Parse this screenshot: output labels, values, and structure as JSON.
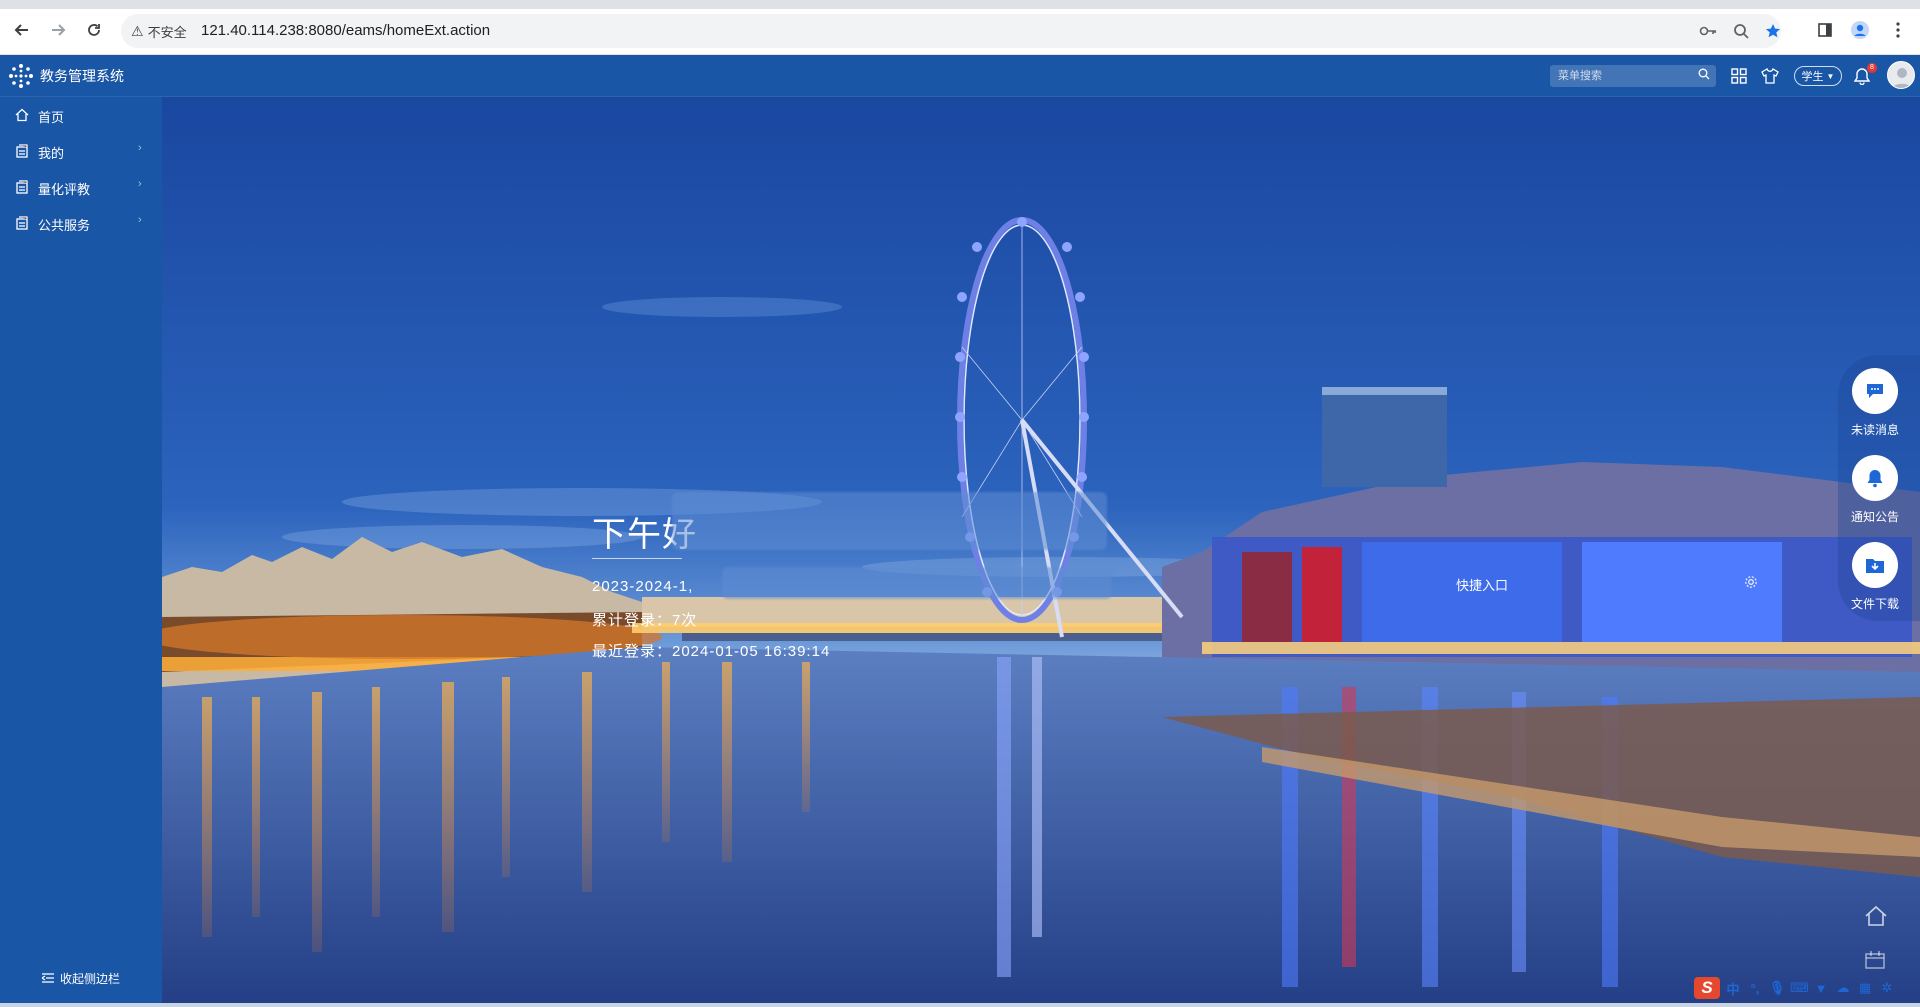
{
  "browser": {
    "security_label": "不安全",
    "url": "121.40.114.238:8080/eams/homeExt.action",
    "icons": [
      "back-icon",
      "forward-icon",
      "reload-icon",
      "key-icon",
      "zoom-icon",
      "star-icon",
      "sidepanel-icon",
      "profile-icon",
      "menu-dots-icon"
    ]
  },
  "header": {
    "app_title": "教务管理系统",
    "search_placeholder": "菜单搜索",
    "role_label": "学生",
    "notification_count": "8"
  },
  "sidebar": {
    "items": [
      {
        "label": "首页",
        "has_children": false
      },
      {
        "label": "我的",
        "has_children": true
      },
      {
        "label": "量化评教",
        "has_children": true
      },
      {
        "label": "公共服务",
        "has_children": true
      }
    ],
    "collapse_label": "收起侧边栏"
  },
  "hero": {
    "greeting": "下午好",
    "term": "2023-2024-1,",
    "login_count": "累计登录：7次",
    "last_login": "最近登录：2024-01-05 16:39:14",
    "quick_entry": "快捷入口"
  },
  "float_panel": {
    "items": [
      {
        "label": "未读消息",
        "icon": "message-icon"
      },
      {
        "label": "通知公告",
        "icon": "bell-icon"
      },
      {
        "label": "文件下载",
        "icon": "download-icon"
      }
    ]
  },
  "ime": {
    "mode": "中",
    "punct": "°,"
  },
  "colors": {
    "header_blue": "#1a56a6",
    "sky_top": "#1a4fa3",
    "accent_blue": "#1f66d6"
  }
}
